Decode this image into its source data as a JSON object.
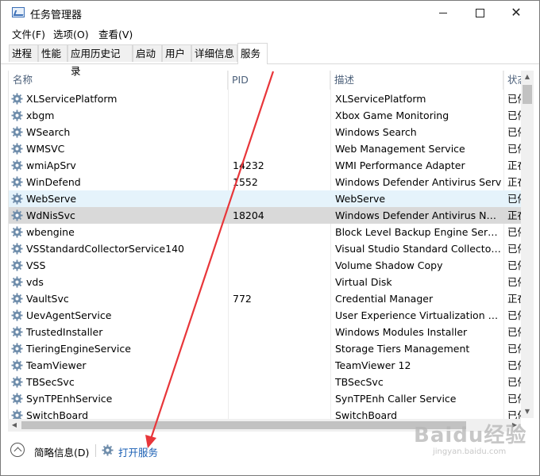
{
  "window": {
    "title": "任务管理器",
    "controls": {
      "minimize": "minimize",
      "maximize": "maximize",
      "close": "✕"
    }
  },
  "menu": {
    "file": "文件(F)",
    "options": "选项(O)",
    "view": "查看(V)"
  },
  "tabs": [
    {
      "label": "进程",
      "active": false
    },
    {
      "label": "性能",
      "active": false
    },
    {
      "label": "应用历史记录",
      "active": false
    },
    {
      "label": "启动",
      "active": false
    },
    {
      "label": "用户",
      "active": false
    },
    {
      "label": "详细信息",
      "active": false
    },
    {
      "label": "服务",
      "active": true
    }
  ],
  "table": {
    "columns": {
      "name": "名称",
      "pid": "PID",
      "description": "描述",
      "status": "状态"
    },
    "rows": [
      {
        "name": "XLServicePlatform",
        "pid": "",
        "description": "XLServicePlatform",
        "status": "已停止"
      },
      {
        "name": "xbgm",
        "pid": "",
        "description": "Xbox Game Monitoring",
        "status": "已停止"
      },
      {
        "name": "WSearch",
        "pid": "",
        "description": "Windows Search",
        "status": "已停止"
      },
      {
        "name": "WMSVC",
        "pid": "",
        "description": "Web Management Service",
        "status": "已停止"
      },
      {
        "name": "wmiApSrv",
        "pid": "14232",
        "description": "WMI Performance Adapter",
        "status": "正在运行"
      },
      {
        "name": "WinDefend",
        "pid": "1552",
        "description": "Windows Defender Antivirus Serv",
        "status": "正在运行"
      },
      {
        "name": "WebServe",
        "pid": "",
        "description": "WebServe",
        "status": "已停止"
      },
      {
        "name": "WdNisSvc",
        "pid": "18204",
        "description": "Windows Defender Antivirus Net...",
        "status": "正在运行"
      },
      {
        "name": "wbengine",
        "pid": "",
        "description": "Block Level Backup Engine Service",
        "status": "已停止"
      },
      {
        "name": "VSStandardCollectorService140",
        "pid": "",
        "description": "Visual Studio Standard Collector ...",
        "status": "已停止"
      },
      {
        "name": "VSS",
        "pid": "",
        "description": "Volume Shadow Copy",
        "status": "已停止"
      },
      {
        "name": "vds",
        "pid": "",
        "description": "Virtual Disk",
        "status": "已停止"
      },
      {
        "name": "VaultSvc",
        "pid": "772",
        "description": "Credential Manager",
        "status": "正在运行"
      },
      {
        "name": "UevAgentService",
        "pid": "",
        "description": "User Experience Virtualization Se...",
        "status": "已停止"
      },
      {
        "name": "TrustedInstaller",
        "pid": "",
        "description": "Windows Modules Installer",
        "status": "已停止"
      },
      {
        "name": "TieringEngineService",
        "pid": "",
        "description": "Storage Tiers Management",
        "status": "已停止"
      },
      {
        "name": "TeamViewer",
        "pid": "",
        "description": "TeamViewer 12",
        "status": "已停止"
      },
      {
        "name": "TBSecSvc",
        "pid": "",
        "description": "TBSecSvc",
        "status": "已停止"
      },
      {
        "name": "SynTPEnhService",
        "pid": "",
        "description": "SynTPEnh Caller Service",
        "status": "已停止"
      },
      {
        "name": "SwitchBoard",
        "pid": "",
        "description": "SwitchBoard",
        "status": "已停止"
      }
    ],
    "hover_row": 6,
    "selected_row": 7
  },
  "footer": {
    "fewer_details": "简略信息(D)",
    "open_services": "打开服务"
  },
  "watermark": {
    "main": "Baidu经验",
    "sub": "jingyan.baidu.com"
  },
  "colors": {
    "link": "#1a5fb4",
    "header_text": "#4c607a",
    "selected_row": "#d9d9d9",
    "hover_row": "#e5f3fb",
    "annotation_arrow": "#e8363a"
  }
}
